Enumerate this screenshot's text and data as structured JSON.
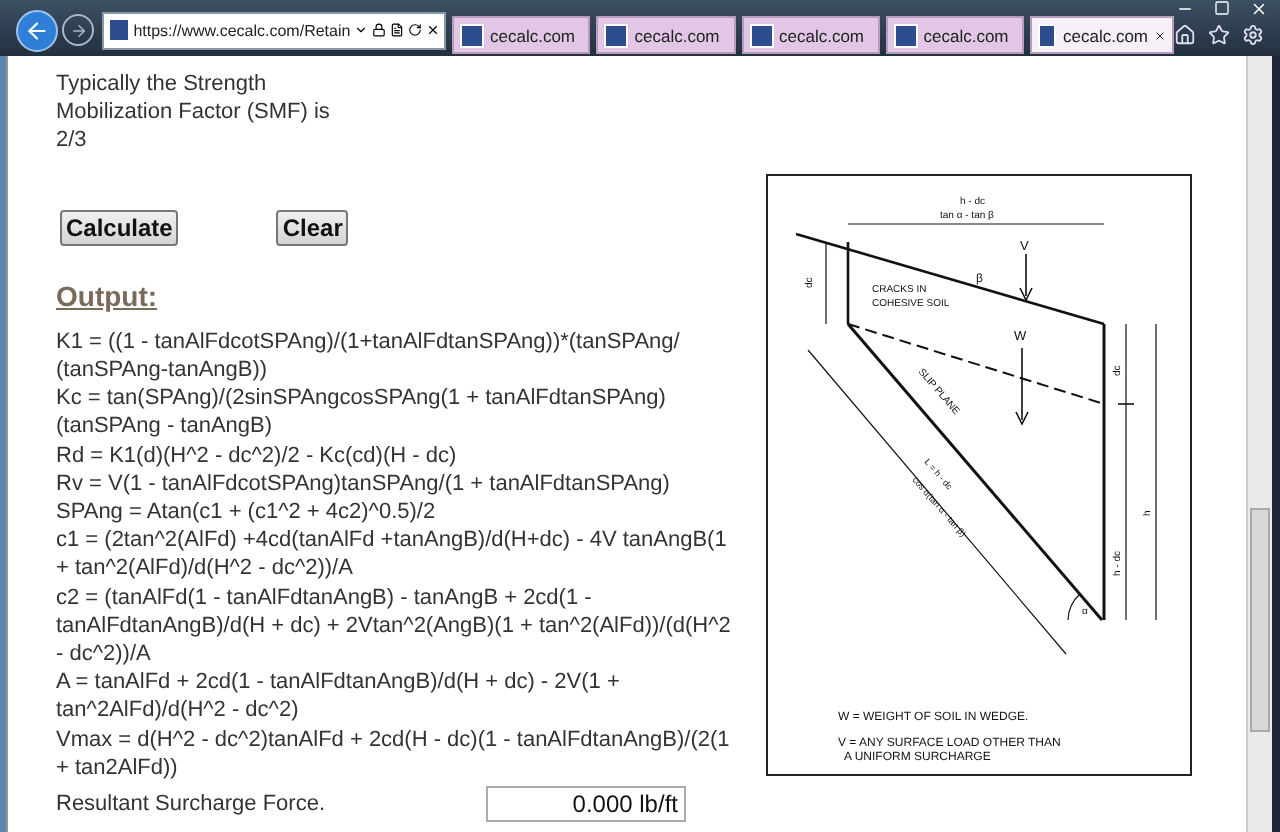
{
  "browser": {
    "address": "https://www.cecalc.com/Retain",
    "tabs": [
      {
        "label": "cecalc.com",
        "selected": false
      },
      {
        "label": "cecalc.com",
        "selected": false
      },
      {
        "label": "cecalc.com",
        "selected": false
      },
      {
        "label": "cecalc.com",
        "selected": false
      },
      {
        "label": "cecalc.com",
        "selected": true
      }
    ]
  },
  "form": {
    "note_lines": [
      "Typically the Strength",
      "Mobilization Factor (SMF) is",
      "2/3"
    ],
    "buttons": [
      "Calculate",
      "Clear"
    ],
    "output_heading": "Output:",
    "formulas": [
      [
        "K1 = ((1 - tanAlFdcotSPAng)/(1+tanAlFdtanSPAng))*(tanSPAng/",
        "(tanSPAng-tanAngB))"
      ],
      [
        "Kc = tan(SPAng)/(2sinSPAngcosSPAng(1 + tanAlFdtanSPAng)",
        "(tanSPAng - tanAngB)"
      ],
      [
        "Rd = K1(d)(H^2 - dc^2)/2 - Kc(cd)(H - dc)"
      ],
      [
        "Rv = V(1 - tanAlFdcotSPAng)tanSPAng/(1 + tanAlFdtanSPAng)"
      ],
      [
        "SPAng = Atan(c1 + (c1^2 + 4c2)^0.5)/2"
      ],
      [
        "c1 = (2tan^2(AlFd) +4cd(tanAlFd +tanAngB)/d(H+dc) - 4V tanAngB(1",
        "+ tan^2(AlFd)/d(H^2 - dc^2))/A"
      ],
      [
        "c2 = (tanAlFd(1 - tanAlFdtanAngB) - tanAngB + 2cd(1 -",
        "tanAlFdtanAngB)/d(H + dc) + 2Vtan^2(AngB)(1 + tan^2(AlFd))/(d(H^2",
        "- dc^2))/A"
      ],
      [
        "A = tanAlFd + 2cd(1 - tanAlFdtanAngB)/d(H + dc) - 2V(1 +",
        "tan^2AlFd)/d(H^2 - dc^2)"
      ],
      [
        "Vmax = d(H^2 - dc^2)tanAlFd + 2cd(H - dc)(1 - tanAlFdtanAngB)/(2(1",
        "+ tan2AlFd))"
      ]
    ],
    "result": {
      "label": "Resultant Surcharge Force.",
      "value": "0.000 lb/ft"
    }
  },
  "figure": {
    "top_dim": [
      "h - dc",
      "tan α - tan β"
    ],
    "load_label": "V",
    "weight_label": "W",
    "angle_beta": "β",
    "angle_alpha": "α",
    "crack_label": [
      "CRACKS IN",
      "COHESIVE SOIL"
    ],
    "slip_label": "SLIP PLANE",
    "left_dim": "dc",
    "right_dims": [
      "dc",
      "h - dc"
    ],
    "height_dim": "h",
    "length_dim": [
      "L = h - dc",
      "cos α(tan α - tan β)"
    ],
    "captions": [
      "W = WEIGHT OF SOIL IN WEDGE.",
      "V = ANY SURFACE LOAD OTHER THAN",
      "A UNIFORM SURCHARGE"
    ]
  }
}
